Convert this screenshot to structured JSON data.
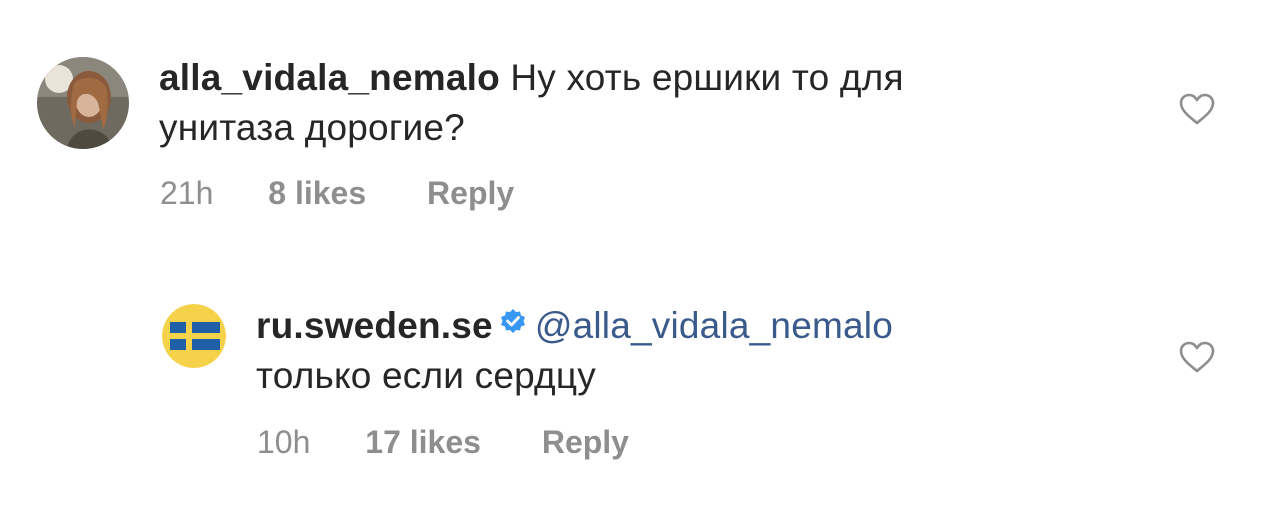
{
  "comments": [
    {
      "username": "alla_vidala_nemalo",
      "line1": "Ну хоть ершики то для",
      "line2": "унитаза дорогие?",
      "time": "21h",
      "likes": "8 likes",
      "reply": "Reply",
      "avatar_icon": "user-photo-avatar",
      "like_icon": "heart-outline-icon"
    },
    {
      "username": "ru.sweden.se",
      "verified_icon": "verified-badge-icon",
      "mention": "@alla_vidala_nemalo",
      "line2": "только если сердцу",
      "time": "10h",
      "likes": "17 likes",
      "reply": "Reply",
      "avatar_icon": "swedish-flag-avatar",
      "like_icon": "heart-outline-icon"
    }
  ],
  "colors": {
    "text": "#262626",
    "meta": "#8e8e8e",
    "mention": "#3a5a8c",
    "verified": "#3897f0",
    "flag_blue": "#1f5fa8",
    "flag_yellow": "#f5d24a"
  }
}
